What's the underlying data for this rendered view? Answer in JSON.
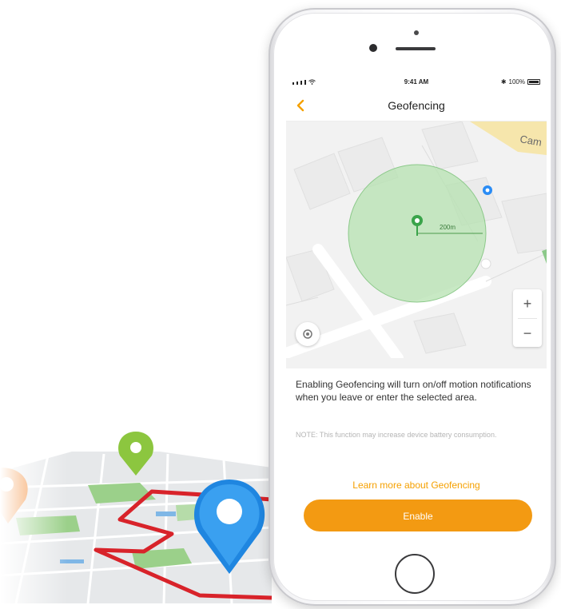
{
  "status_bar": {
    "time": "9:41 AM",
    "battery_text": "100%",
    "bluetooth_icon": "bluetooth-icon",
    "wifi_icon": "wifi-icon"
  },
  "nav": {
    "title": "Geofencing",
    "back_icon": "chevron-left-icon"
  },
  "map": {
    "street_label": "Cam",
    "radius_label": "200m",
    "center_pin_color": "#3aa44a",
    "geofence_fill": "#b5e2b0",
    "user_dot_color": "#2a8cf5"
  },
  "controls": {
    "zoom_in": "+",
    "zoom_out": "−",
    "locate_icon": "target-icon"
  },
  "info": {
    "description": "Enabling Geofencing will turn on/off motion notifications when you leave or enter the selected area.",
    "note": "NOTE: This function may increase device battery consumption.",
    "learn_more": "Learn more about Geofencing",
    "enable_button": "Enable"
  },
  "colors": {
    "accent": "#f39a12",
    "accent_text": "#f5a000"
  }
}
